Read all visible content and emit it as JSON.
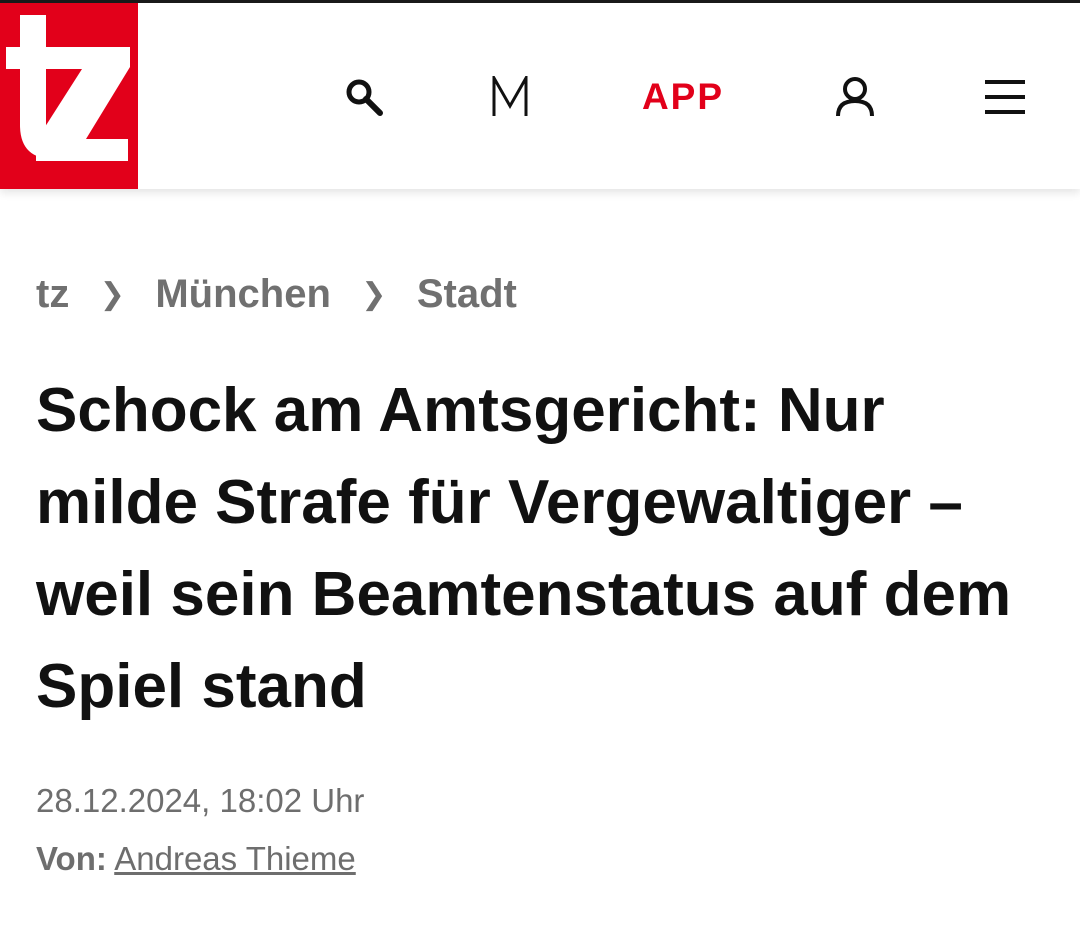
{
  "header": {
    "logo_text": "tz",
    "brand_color": "#e2001a",
    "icons": {
      "search": "search-icon",
      "merkur": "m-icon",
      "user": "user-icon",
      "menu": "menu-icon"
    },
    "app_label": "APP"
  },
  "breadcrumb": {
    "items": [
      "tz",
      "München",
      "Stadt"
    ],
    "separator": "❯"
  },
  "article": {
    "headline": "Schock am Amtsgericht: Nur milde Strafe für Vergewaltiger – weil sein Beamtenstatus auf dem Spiel stand",
    "date": "28.12.2024, 18:02 Uhr",
    "author_prefix": "Von:",
    "author_name": "Andreas Thieme"
  }
}
